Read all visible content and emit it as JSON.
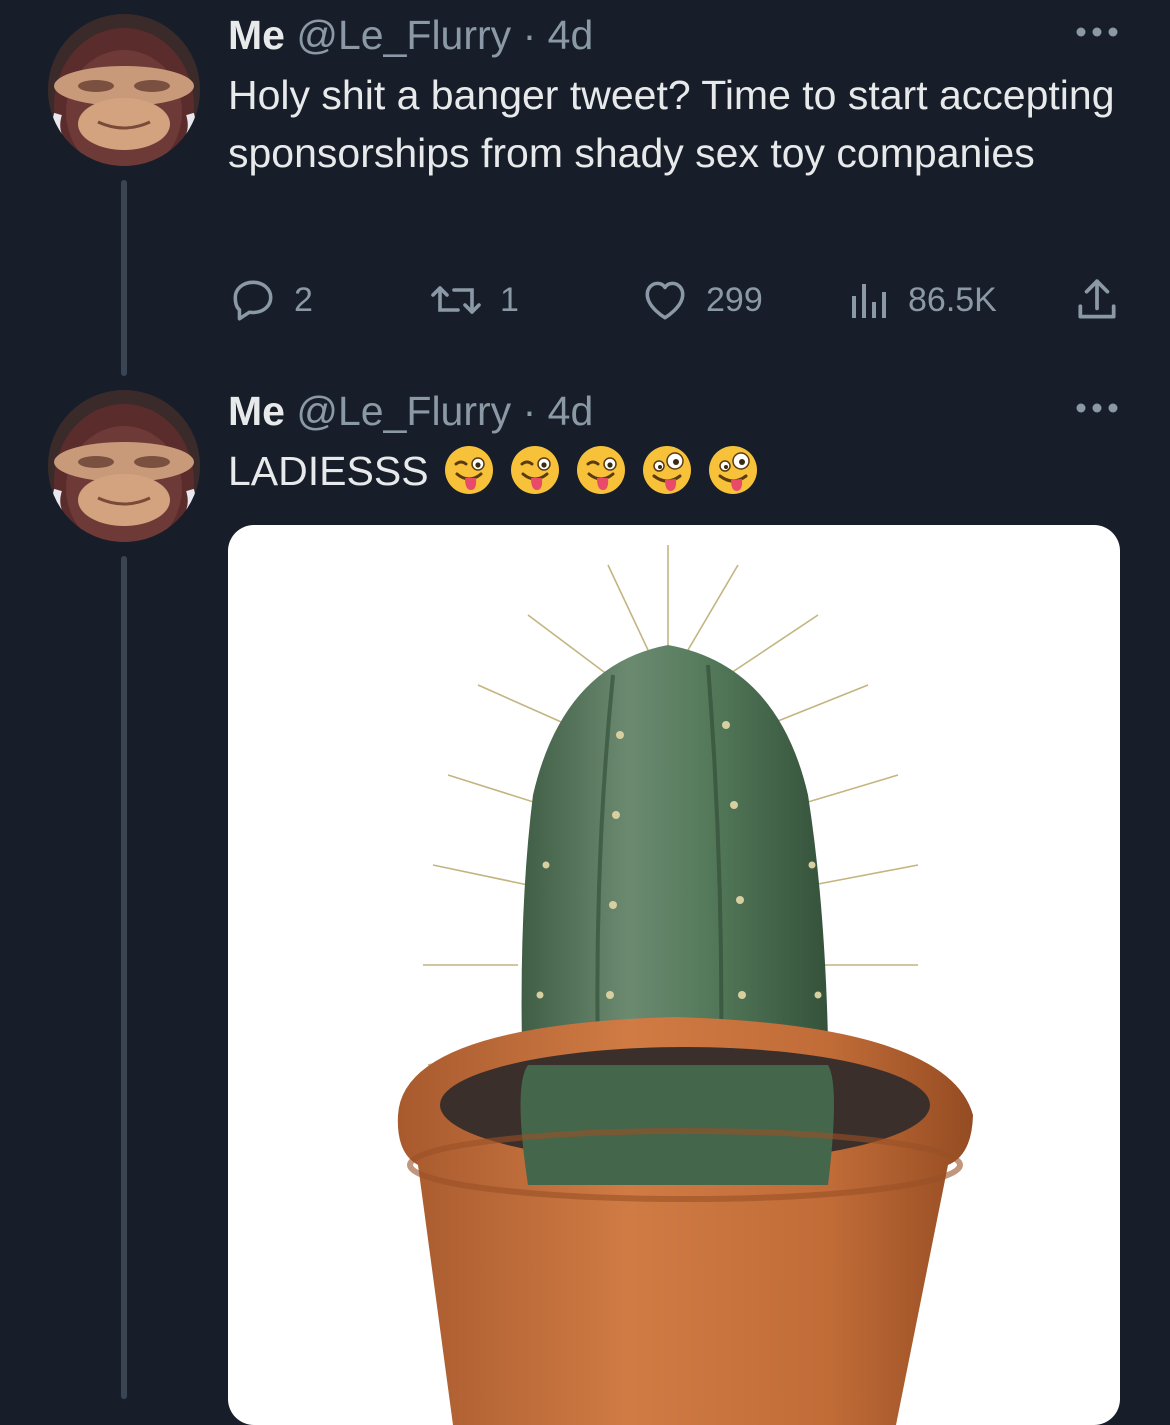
{
  "tweets": [
    {
      "name": "Me",
      "handle": "@Le_Flurry",
      "separator": "·",
      "time": "4d",
      "text": "Holy shit a banger tweet? Time to start accepting sponsorships from shady sex toy companies",
      "replies": "2",
      "retweets": "1",
      "likes": "299",
      "views": "86.5K"
    },
    {
      "name": "Me",
      "handle": "@Le_Flurry",
      "separator": "·",
      "time": "4d",
      "text": "LADIESSS",
      "emojis": [
        "zany-tongue-face-emoji",
        "zany-tongue-face-emoji",
        "zany-tongue-face-emoji",
        "crazy-eyes-face-emoji",
        "crazy-eyes-face-emoji"
      ]
    }
  ],
  "icons": {
    "reply": "reply-icon",
    "retweet": "retweet-icon",
    "like": "heart-icon",
    "views": "views-bar-icon",
    "share": "share-icon",
    "more": "more-dots-icon"
  },
  "colors": {
    "background": "#171e29",
    "primary_text": "#e7e9ea",
    "secondary_text": "#8b98a5",
    "thread_line": "#3a4452"
  }
}
